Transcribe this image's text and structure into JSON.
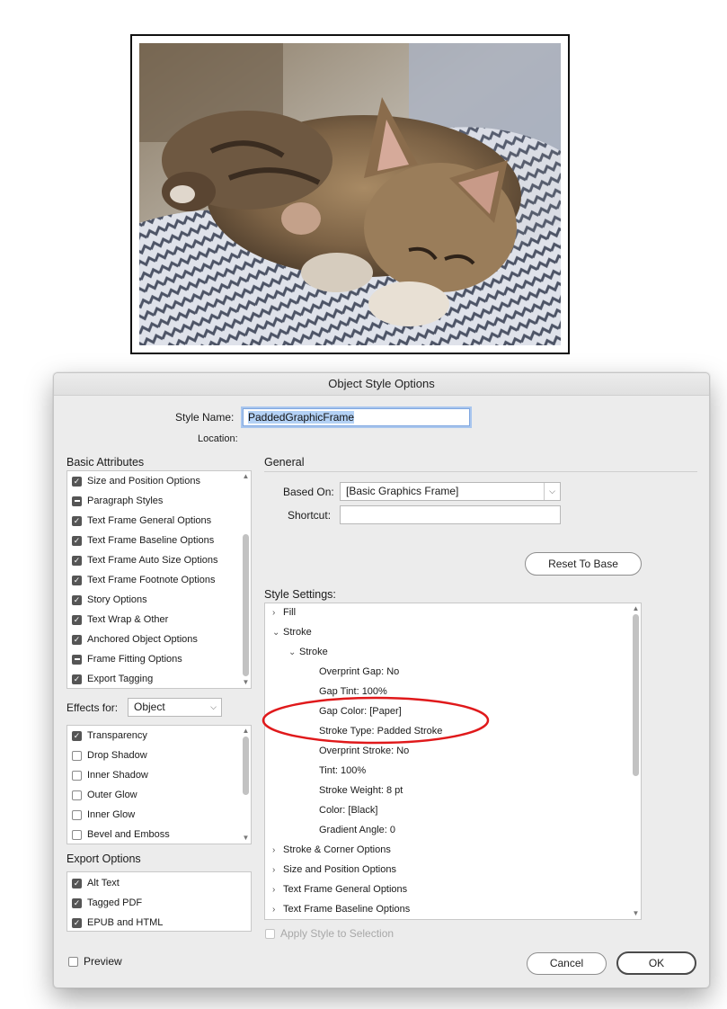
{
  "dialog": {
    "title": "Object Style Options",
    "style_name_label": "Style Name:",
    "style_name_value": "PaddedGraphicFrame",
    "location_label": "Location:"
  },
  "basic_attributes": {
    "title": "Basic Attributes",
    "items": [
      {
        "label": "Size and Position Options",
        "state": "on"
      },
      {
        "label": "Paragraph Styles",
        "state": "mixed"
      },
      {
        "label": "Text Frame General Options",
        "state": "on"
      },
      {
        "label": "Text Frame Baseline Options",
        "state": "on"
      },
      {
        "label": "Text Frame Auto Size Options",
        "state": "on"
      },
      {
        "label": "Text Frame Footnote Options",
        "state": "on"
      },
      {
        "label": "Story Options",
        "state": "on"
      },
      {
        "label": "Text Wrap & Other",
        "state": "on"
      },
      {
        "label": "Anchored Object Options",
        "state": "on"
      },
      {
        "label": "Frame Fitting Options",
        "state": "mixed"
      },
      {
        "label": "Export Tagging",
        "state": "on"
      }
    ]
  },
  "effects": {
    "label": "Effects for:",
    "selected": "Object",
    "items": [
      {
        "label": "Transparency",
        "state": "on"
      },
      {
        "label": "Drop Shadow",
        "state": "off"
      },
      {
        "label": "Inner Shadow",
        "state": "off"
      },
      {
        "label": "Outer Glow",
        "state": "off"
      },
      {
        "label": "Inner Glow",
        "state": "off"
      },
      {
        "label": "Bevel and Emboss",
        "state": "off"
      }
    ]
  },
  "export_options": {
    "title": "Export Options",
    "items": [
      {
        "label": "Alt Text",
        "state": "on"
      },
      {
        "label": "Tagged PDF",
        "state": "on"
      },
      {
        "label": "EPUB and HTML",
        "state": "on"
      }
    ]
  },
  "general": {
    "title": "General",
    "based_on_label": "Based On:",
    "based_on_value": "[Basic Graphics Frame]",
    "shortcut_label": "Shortcut:",
    "shortcut_value": "",
    "reset_button": "Reset To Base"
  },
  "style_settings": {
    "title": "Style Settings:",
    "items": [
      {
        "label": "Fill",
        "twisty": "closed",
        "indent": 0
      },
      {
        "label": "Stroke",
        "twisty": "open",
        "indent": 0
      },
      {
        "label": "Stroke",
        "twisty": "open",
        "indent": 1
      },
      {
        "label": "Overprint Gap: No",
        "twisty": "none",
        "indent": 2
      },
      {
        "label": "Gap Tint: 100%",
        "twisty": "none",
        "indent": 2
      },
      {
        "label": "Gap Color: [Paper]",
        "twisty": "none",
        "indent": 2
      },
      {
        "label": "Stroke Type: Padded Stroke",
        "twisty": "none",
        "indent": 2
      },
      {
        "label": "Overprint Stroke: No",
        "twisty": "none",
        "indent": 2
      },
      {
        "label": "Tint: 100%",
        "twisty": "none",
        "indent": 2
      },
      {
        "label": "Stroke Weight: 8 pt",
        "twisty": "none",
        "indent": 2
      },
      {
        "label": "Color: [Black]",
        "twisty": "none",
        "indent": 2
      },
      {
        "label": "Gradient Angle: 0",
        "twisty": "none",
        "indent": 2
      },
      {
        "label": "Stroke & Corner Options",
        "twisty": "closed",
        "indent": 0
      },
      {
        "label": "Size and Position Options",
        "twisty": "closed",
        "indent": 0
      },
      {
        "label": "Text Frame General Options",
        "twisty": "closed",
        "indent": 0
      },
      {
        "label": "Text Frame Baseline Options",
        "twisty": "closed",
        "indent": 0
      }
    ]
  },
  "footer": {
    "apply_label": "Apply Style to Selection",
    "preview_label": "Preview",
    "cancel_button": "Cancel",
    "ok_button": "OK"
  },
  "colors": {
    "highlight_ellipse": "#e0191b",
    "checkbox_on": "#555555",
    "focus_ring": "#a9c6ee"
  }
}
